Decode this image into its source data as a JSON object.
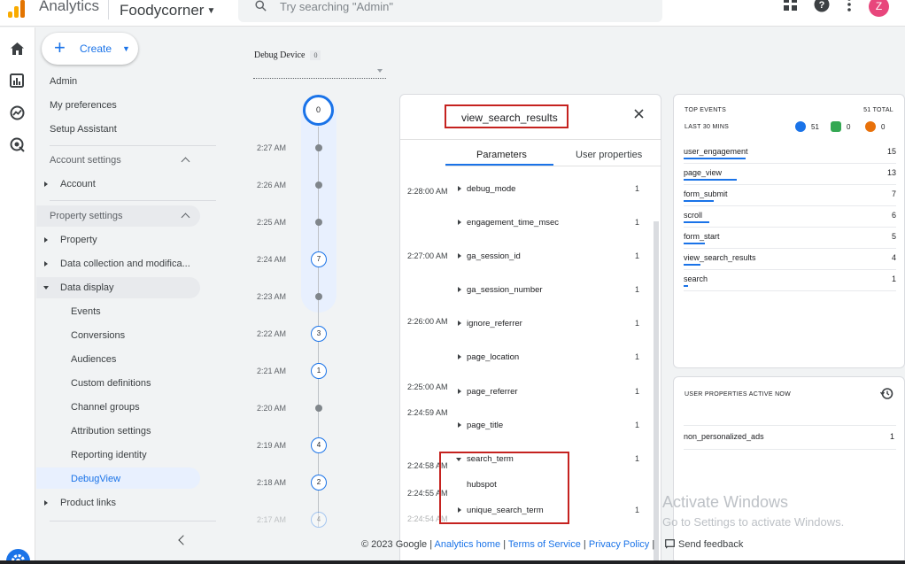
{
  "topbar": {
    "app_name": "Analytics",
    "property": "Foodycorner",
    "search_placeholder": "Try searching \"Admin\"",
    "avatar_letter": "Z",
    "icons": [
      "apps-grid-icon",
      "help-icon",
      "more-vert-icon"
    ]
  },
  "rail": {
    "icons": [
      "home-icon",
      "reports-icon",
      "explore-icon",
      "advertising-icon",
      "admin-gear-icon"
    ]
  },
  "nav": {
    "create_label": "Create",
    "items_top": [
      "Admin",
      "My preferences",
      "Setup Assistant"
    ],
    "account_settings": "Account settings",
    "account": "Account",
    "property_settings": "Property settings",
    "property": "Property",
    "data_collection": "Data collection and modifica...",
    "data_display": "Data display",
    "data_display_items": [
      "Events",
      "Conversions",
      "Audiences",
      "Custom definitions",
      "Channel groups",
      "Attribution settings",
      "Reporting identity",
      "DebugView"
    ],
    "product_links": "Product links"
  },
  "debug": {
    "device_label": "Debug Device",
    "device_count": "0",
    "top_count": "0",
    "timeline": [
      {
        "time": "2:27 AM",
        "count": ""
      },
      {
        "time": "2:26 AM",
        "count": ""
      },
      {
        "time": "2:25 AM",
        "count": ""
      },
      {
        "time": "2:24 AM",
        "count": "7"
      },
      {
        "time": "2:23 AM",
        "count": ""
      },
      {
        "time": "2:22 AM",
        "count": "3"
      },
      {
        "time": "2:21 AM",
        "count": "1"
      },
      {
        "time": "2:20 AM",
        "count": ""
      },
      {
        "time": "2:19 AM",
        "count": "4"
      },
      {
        "time": "2:18 AM",
        "count": "2"
      },
      {
        "time": "2:17 AM",
        "count": "4"
      }
    ]
  },
  "event_panel": {
    "event_name": "view_search_results",
    "tab_params": "Parameters",
    "tab_user": "User properties",
    "times": [
      "2:28:00 AM",
      "2:27:00 AM",
      "2:26:00 AM",
      "2:25:00 AM",
      "2:24:59 AM",
      "2:24:58 AM",
      "2:24:55 AM",
      "2:24:54 AM"
    ],
    "params": [
      {
        "name": "debug_mode",
        "count": "1"
      },
      {
        "name": "engagement_time_msec",
        "count": "1"
      },
      {
        "name": "ga_session_id",
        "count": "1"
      },
      {
        "name": "ga_session_number",
        "count": "1"
      },
      {
        "name": "ignore_referrer",
        "count": "1"
      },
      {
        "name": "page_location",
        "count": "1"
      },
      {
        "name": "page_referrer",
        "count": "1"
      },
      {
        "name": "page_title",
        "count": "1"
      },
      {
        "name": "search_term",
        "count": "1"
      },
      {
        "name": "unique_search_term",
        "count": "1"
      }
    ],
    "search_term_value": "hubspot"
  },
  "top_events": {
    "title": "TOP EVENTS",
    "total": "51 TOTAL",
    "window": "LAST 30 MINS",
    "badges": [
      {
        "value": "51",
        "color": "#1a73e8"
      },
      {
        "value": "0",
        "color": "#34a853"
      },
      {
        "value": "0",
        "color": "#e8710a"
      }
    ],
    "rows": [
      {
        "name": "user_engagement",
        "count": "15",
        "share": 0.29
      },
      {
        "name": "page_view",
        "count": "13",
        "share": 0.25
      },
      {
        "name": "form_submit",
        "count": "7",
        "share": 0.14
      },
      {
        "name": "scroll",
        "count": "6",
        "share": 0.12
      },
      {
        "name": "form_start",
        "count": "5",
        "share": 0.1
      },
      {
        "name": "view_search_results",
        "count": "4",
        "share": 0.08
      },
      {
        "name": "search",
        "count": "1",
        "share": 0.02
      }
    ]
  },
  "user_props": {
    "title": "USER PROPERTIES ACTIVE NOW",
    "rows": [
      {
        "name": "non_personalized_ads",
        "count": "1"
      }
    ]
  },
  "footer": {
    "copyright": "© 2023 Google |",
    "analytics_home": "Analytics home",
    "terms": "Terms of Service",
    "privacy": "Privacy Policy",
    "sep": "|",
    "feedback": "Send feedback"
  },
  "watermark": {
    "line1": "Activate Windows",
    "line2": "Go to Settings to activate Windows."
  },
  "colors": {
    "accent": "#1a73e8",
    "highlight_box": "#c5221f",
    "selected_nav": "#e8f0fe"
  }
}
